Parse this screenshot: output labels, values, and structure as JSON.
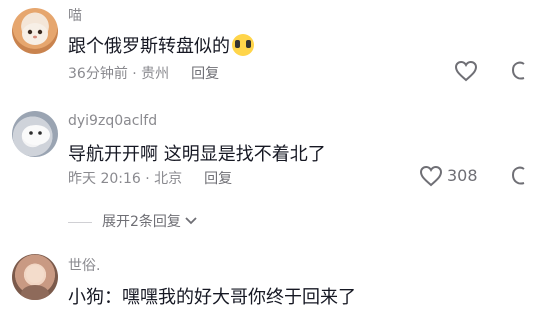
{
  "comments": [
    {
      "username": "喵",
      "text": "跟个俄罗斯转盘似的",
      "emoji": "dizzy-face-emoji",
      "time_location": "36分钟前 · 贵州",
      "reply_label": "回复",
      "likes": ""
    },
    {
      "username": "dyi9zq0aclfd",
      "text": "导航开开啊 这明显是找不着北了",
      "time_location": "昨天 20:16 · 北京",
      "reply_label": "回复",
      "likes": "308"
    },
    {
      "username": "世俗.",
      "text": "小狗：嘿嘿我的好大哥你终于回来了"
    }
  ],
  "expand_replies": {
    "label": "展开2条回复"
  },
  "colors": {
    "text": "#161823",
    "meta": "#8a8a8f"
  }
}
